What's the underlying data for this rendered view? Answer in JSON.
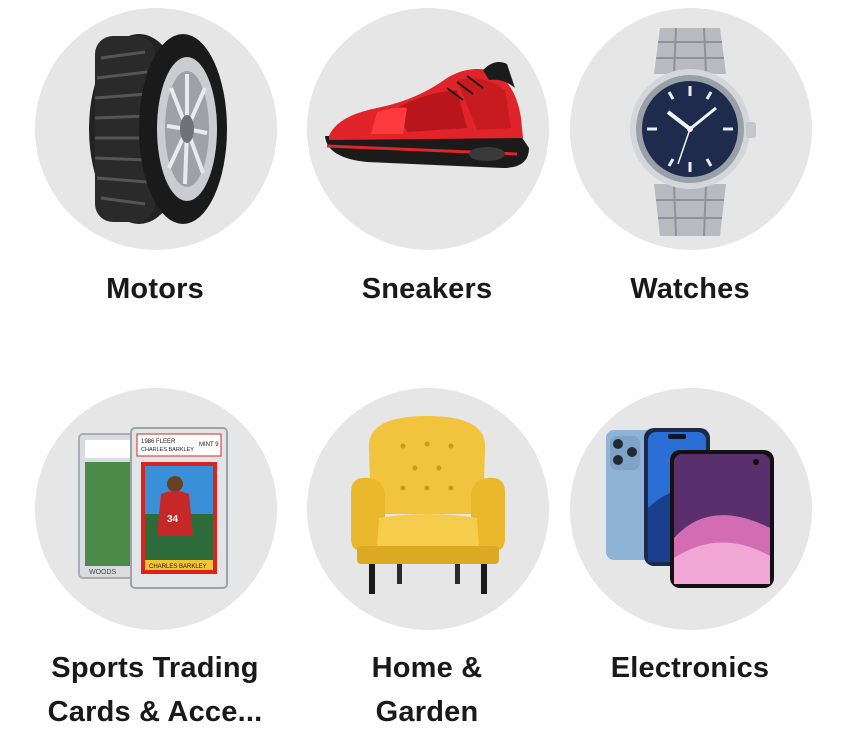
{
  "categories": [
    {
      "label": "Motors",
      "icon": "tire-icon"
    },
    {
      "label": "Sneakers",
      "icon": "sneaker-icon"
    },
    {
      "label": "Watches",
      "icon": "watch-icon"
    },
    {
      "label": "Sports Trading Cards & Acce...",
      "line1": "Sports Trading",
      "line2": "Cards & Acce...",
      "icon": "trading-card-icon",
      "card_text": {
        "header1": "1986 FLEER",
        "header2": "CHARLES BARKLEY",
        "grade": "MINT 9",
        "number": "34",
        "nameplate": "CHARLES BARKLEY",
        "back_name": "WOODS"
      }
    },
    {
      "label": "Home & Garden",
      "line1": "Home &",
      "line2": "Garden",
      "icon": "armchair-icon"
    },
    {
      "label": "Electronics",
      "icon": "smartphones-icon"
    }
  ],
  "colors": {
    "circle_bg": "#e6e6e6",
    "label_text": "#191919",
    "sneaker_red": "#e0242a",
    "chair_yellow": "#f2c43d",
    "watch_dial": "#1e2b4d",
    "phone_blue": "#8fb3d4"
  }
}
